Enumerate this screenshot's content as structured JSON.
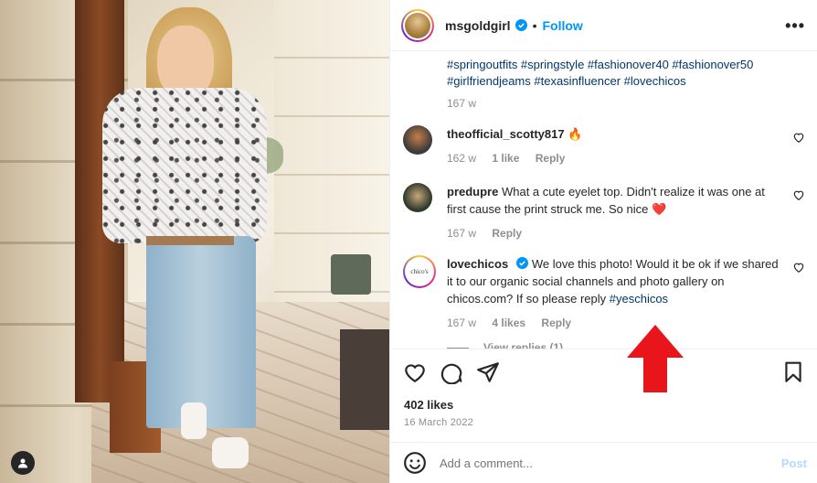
{
  "post": {
    "username": "msgoldgirl",
    "dot": "•",
    "follow_label": "Follow",
    "more_label": "•••"
  },
  "caption": {
    "hashtags_line1": "#springoutfits #springstyle #fashionover40 #fashionover50",
    "hashtags_line2": "#girlfriendjeams #texasinfluencer #lovechicos",
    "time": "167 w"
  },
  "comments": [
    {
      "username": "theofficial_scotty817",
      "text": "",
      "emoji": "🔥",
      "time": "162 w",
      "likes": "1 like",
      "reply": "Reply"
    },
    {
      "username": "predupre",
      "text": "What a cute eyelet top. Didn't realize it was one at first cause the print struck me. So nice",
      "emoji": "❤️",
      "time": "167 w",
      "likes": "",
      "reply": "Reply"
    },
    {
      "username": "lovechicos",
      "text": "We love this photo! Would it be ok if we shared it to our organic social channels and photo gallery on chicos.com? If so please reply ",
      "tag": "#yeschicos",
      "avatar_text": "chico's",
      "time": "167 w",
      "likes": "4 likes",
      "reply": "Reply"
    }
  ],
  "view_replies": "View replies (1)",
  "likes_count": "402 likes",
  "post_date": "16 March 2022",
  "comment_box": {
    "placeholder": "Add a comment...",
    "post_label": "Post"
  },
  "colors": {
    "link_blue": "#0095f6",
    "hashtag": "#00376b",
    "arrow_red": "#e8161b"
  },
  "icons": [
    "heart-icon",
    "comment-icon",
    "share-icon",
    "bookmark-icon",
    "emoji-icon",
    "verified-badge-icon",
    "user-icon"
  ]
}
